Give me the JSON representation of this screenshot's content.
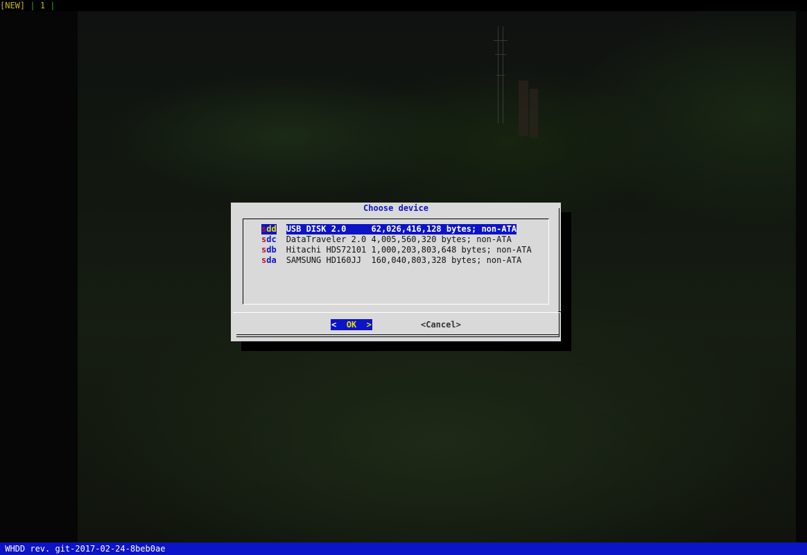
{
  "topbar": {
    "window_tag": "[NEW]",
    "separator": " | ",
    "window_number": "1",
    "trailing_separator": " |"
  },
  "dialog": {
    "title": "Choose device",
    "devices": [
      {
        "tag_first": "s",
        "tag_rest": "dd",
        "description": "USB DISK 2.0     62,026,416,128 bytes; non-ATA",
        "selected": true
      },
      {
        "tag_first": "s",
        "tag_rest": "dc",
        "description": "DataTraveler 2.0 4,005,560,320 bytes; non-ATA",
        "selected": false
      },
      {
        "tag_first": "s",
        "tag_rest": "db",
        "description": "Hitachi HDS72101 1,000,203,803,648 bytes; non-ATA",
        "selected": false
      },
      {
        "tag_first": "s",
        "tag_rest": "da",
        "description": "SAMSUNG HD160JJ  160,040,803,328 bytes; non-ATA",
        "selected": false
      }
    ],
    "ok_button": {
      "left": "<  ",
      "hotkey": "O",
      "rest": "K  >"
    },
    "cancel_button": "<Cancel>"
  },
  "statusbar": {
    "text": " WHDD rev. git-2017-02-24-8beb0ae"
  },
  "colors": {
    "accent_blue": "#0c14c8",
    "highlight_yellow": "#e8e100",
    "tag_red": "#c0152b",
    "dialog_bg": "#d9d9d9"
  }
}
